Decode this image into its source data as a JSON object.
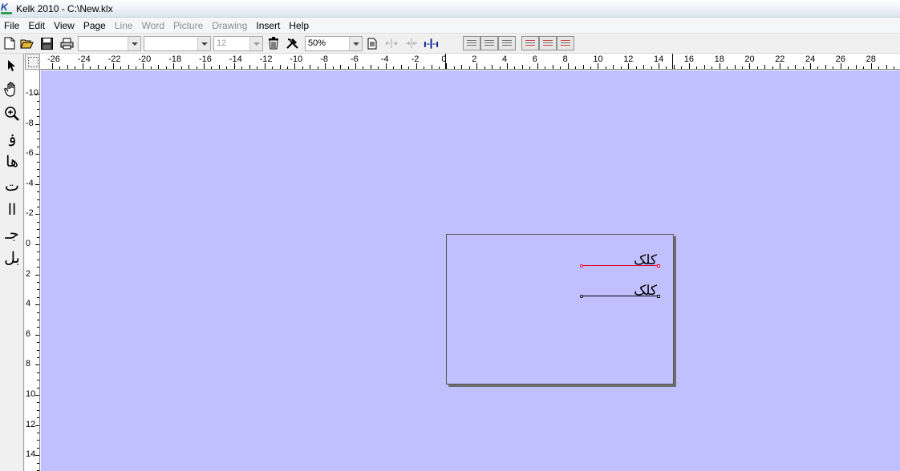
{
  "window": {
    "title": "Kelk 2010 - C:\\New.klx"
  },
  "menu": [
    {
      "label": "File",
      "enabled": true
    },
    {
      "label": "Edit",
      "enabled": true
    },
    {
      "label": "View",
      "enabled": true
    },
    {
      "label": "Page",
      "enabled": true
    },
    {
      "label": "Line",
      "enabled": false
    },
    {
      "label": "Word",
      "enabled": false
    },
    {
      "label": "Picture",
      "enabled": false
    },
    {
      "label": "Drawing",
      "enabled": false
    },
    {
      "label": "Insert",
      "enabled": true
    },
    {
      "label": "Help",
      "enabled": true
    }
  ],
  "toolbar": {
    "font_combo_value": "",
    "style_combo_value": "",
    "size_value": "12",
    "zoom_value": "50%",
    "icons": [
      "new-file-icon",
      "open-folder-icon",
      "save-icon",
      "print-icon",
      "trash-icon",
      "tools-icon",
      "page-settings-icon",
      "align-left-right-icon",
      "align-center-icon",
      "justify-icon",
      "align-left-box-icon",
      "align-center-box-icon",
      "align-right-box-icon",
      "indent-left-icon",
      "indent-center-icon",
      "indent-right-icon"
    ]
  },
  "tools": [
    {
      "name": "pointer-icon",
      "glyph": "➤"
    },
    {
      "name": "hand-icon",
      "glyph": "✋"
    },
    {
      "name": "zoom-icon",
      "glyph": "⊕"
    },
    {
      "name": "kashida-tool-icon",
      "glyph": "ۏ"
    },
    {
      "name": "ligature-tool-icon",
      "glyph": "ها"
    },
    {
      "name": "stretch-tool-icon",
      "glyph": "ت"
    },
    {
      "name": "alef-tool-icon",
      "glyph": "اا"
    },
    {
      "name": "jim-tool-icon",
      "glyph": "جـ"
    },
    {
      "name": "ba-tool-icon",
      "glyph": "بل"
    }
  ],
  "rulers": {
    "horizontal_labels": [
      "-26",
      "-24",
      "-22",
      "-20",
      "-18",
      "-16",
      "-14",
      "-12",
      "-10",
      "-8",
      "-6",
      "-4",
      "-2",
      "0",
      "2",
      "4",
      "6",
      "8",
      "10",
      "12",
      "14",
      "16",
      "18",
      "20",
      "22",
      "24",
      "26",
      "28"
    ],
    "vertical_labels": [
      "-10",
      "-8",
      "-6",
      "-4",
      "-2",
      "0",
      "2",
      "4",
      "6",
      "8",
      "10",
      "12",
      "14"
    ]
  },
  "document": {
    "lines": [
      {
        "text": "کلک",
        "selected": true
      },
      {
        "text": "کلک",
        "selected": false
      }
    ]
  },
  "colors": {
    "canvas_bg": "#c0c0ff",
    "selected_line": "#e8002a",
    "normal_line": "#000000"
  }
}
